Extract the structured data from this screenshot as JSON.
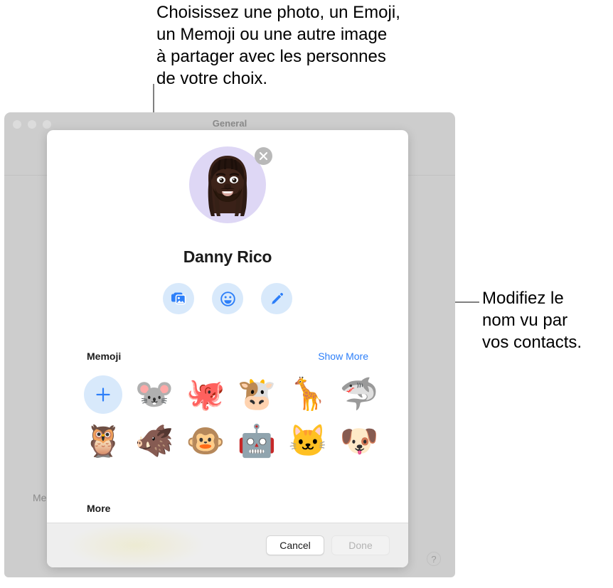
{
  "callouts": {
    "top": "Choisissez une photo, un Emoji,\nun Memoji ou une autre image\nà partager avec les personnes\nde votre choix.",
    "right": "Modifiez le\nnom vu par\nvos contacts."
  },
  "app_window": {
    "title": "General",
    "background_label": "Me",
    "help_icon": "?",
    "traffic_lights": [
      "close-dot",
      "minimize-dot",
      "zoom-dot"
    ]
  },
  "sheet": {
    "avatar": {
      "name": "memoji-avatar",
      "background_color": "#ded7f5",
      "remove_icon": "close-icon"
    },
    "profile_name": "Danny Rico",
    "actions": [
      {
        "name": "choose-photo-button",
        "icon": "photos-icon"
      },
      {
        "name": "choose-emoji-button",
        "icon": "emoji-smiley-icon"
      },
      {
        "name": "edit-name-button",
        "icon": "pencil-icon"
      }
    ],
    "memoji_section": {
      "title": "Memoji",
      "show_more_label": "Show More",
      "add_icon": "plus-icon",
      "rows": [
        [
          {
            "name": "add-memoji-button",
            "glyph": "+",
            "label": "add"
          },
          {
            "name": "memoji-mouse",
            "glyph": "🐭",
            "label": "mouse"
          },
          {
            "name": "memoji-octopus",
            "glyph": "🐙",
            "label": "octopus"
          },
          {
            "name": "memoji-cow",
            "glyph": "🐮",
            "label": "cow"
          },
          {
            "name": "memoji-giraffe",
            "glyph": "🦒",
            "label": "giraffe"
          },
          {
            "name": "memoji-shark",
            "glyph": "🦈",
            "label": "shark"
          }
        ],
        [
          {
            "name": "memoji-owl",
            "glyph": "🦉",
            "label": "owl"
          },
          {
            "name": "memoji-boar",
            "glyph": "🐗",
            "label": "boar"
          },
          {
            "name": "memoji-monkey",
            "glyph": "🐵",
            "label": "monkey"
          },
          {
            "name": "memoji-robot",
            "glyph": "🤖",
            "label": "robot"
          },
          {
            "name": "memoji-cat",
            "glyph": "🐱",
            "label": "cat"
          },
          {
            "name": "memoji-dog",
            "glyph": "🐶",
            "label": "dog"
          }
        ]
      ]
    },
    "more_section": {
      "title": "More"
    },
    "footer": {
      "cancel_label": "Cancel",
      "done_label": "Done",
      "done_enabled": false
    }
  },
  "colors": {
    "accent_blue": "#2d7ff9",
    "action_button_bg": "#d8e9fb",
    "window_gray": "#cdcdcd",
    "leader_line": "#808080"
  }
}
